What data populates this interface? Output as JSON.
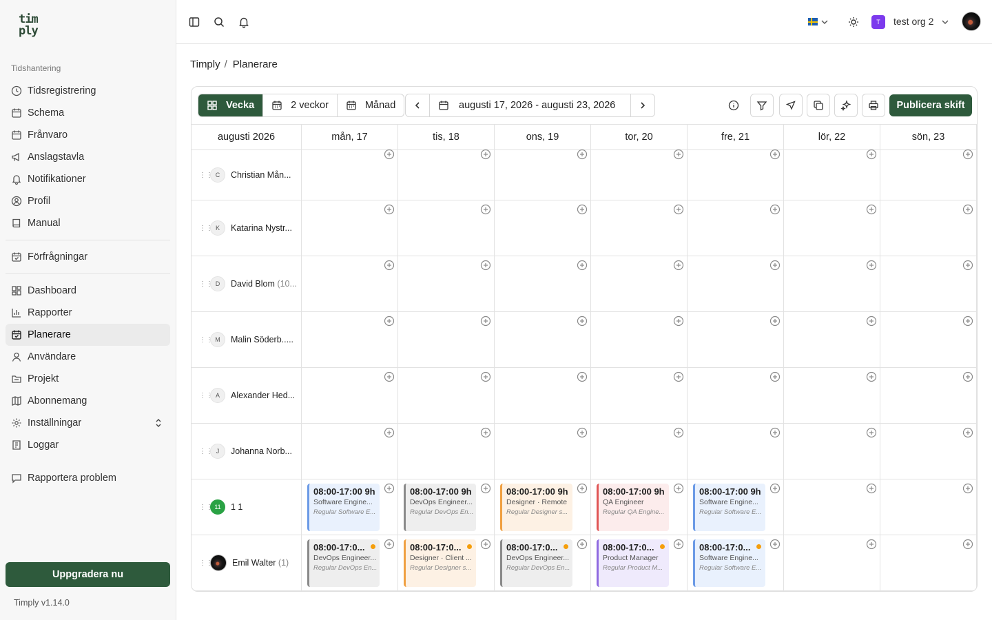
{
  "logo": {
    "line1": "tim",
    "line2": "ply"
  },
  "sidebar": {
    "section_label": "Tidshantering",
    "items": [
      {
        "label": "Tidsregistrering",
        "icon": "clock-icon"
      },
      {
        "label": "Schema",
        "icon": "calendar-icon"
      },
      {
        "label": "Frånvaro",
        "icon": "calendar-icon"
      },
      {
        "label": "Anslagstavla",
        "icon": "megaphone-icon"
      },
      {
        "label": "Notifikationer",
        "icon": "bell-icon"
      },
      {
        "label": "Profil",
        "icon": "user-circle-icon"
      },
      {
        "label": "Manual",
        "icon": "book-icon"
      },
      {
        "label": "Förfrågningar",
        "icon": "calendar-check-icon"
      },
      {
        "label": "Dashboard",
        "icon": "dashboard-icon"
      },
      {
        "label": "Rapporter",
        "icon": "bar-chart-icon"
      },
      {
        "label": "Planerare",
        "icon": "calendar-check-icon",
        "active": true
      },
      {
        "label": "Användare",
        "icon": "user-icon"
      },
      {
        "label": "Projekt",
        "icon": "folder-icon"
      },
      {
        "label": "Abonnemang",
        "icon": "map-icon"
      },
      {
        "label": "Inställningar",
        "icon": "gear-icon"
      },
      {
        "label": "Loggar",
        "icon": "log-icon"
      },
      {
        "label": "Rapportera problem",
        "icon": "message-icon"
      }
    ],
    "upgrade_label": "Uppgradera nu",
    "version": "Timply v1.14.0"
  },
  "topbar": {
    "org_badge": "T",
    "org_name": "test org 2"
  },
  "breadcrumb": [
    "Timply",
    "Planerare"
  ],
  "toolbar": {
    "views": [
      "Vecka",
      "2 veckor",
      "Månad"
    ],
    "active_view": "Vecka",
    "date_range": "augusti 17, 2026 - augusti 23, 2026",
    "publish_label": "Publicera skift"
  },
  "grid": {
    "month_label": "augusti 2026",
    "days": [
      "mån, 17",
      "tis, 18",
      "ons, 19",
      "tor, 20",
      "fre, 21",
      "lör, 22",
      "sön, 23"
    ],
    "employees": [
      {
        "initial": "C",
        "name": "Christian Mån...",
        "count": ""
      },
      {
        "initial": "K",
        "name": "Katarina Nystr...",
        "count": ""
      },
      {
        "initial": "D",
        "name": "David Blom",
        "count": "(10..."
      },
      {
        "initial": "M",
        "name": "Malin Söderb.....",
        "count": ""
      },
      {
        "initial": "A",
        "name": "Alexander Hed...",
        "count": ""
      },
      {
        "initial": "J",
        "name": "Johanna Norb...",
        "count": ""
      },
      {
        "initial": "11",
        "name": "1 1",
        "count": "",
        "avatar": "green"
      },
      {
        "initial": "",
        "name": "Emil Walter",
        "count": "(1)",
        "avatar": "photo"
      }
    ],
    "shifts_row7": [
      {
        "day": 0,
        "time": "08:00-17:00 9h",
        "role": "Software Engine...",
        "desc": "Regular Software E...",
        "color": "blue"
      },
      {
        "day": 1,
        "time": "08:00-17:00 9h",
        "role": "DevOps Engineer...",
        "desc": "Regular DevOps En...",
        "color": "gray"
      },
      {
        "day": 2,
        "time": "08:00-17:00 9h",
        "role": "Designer · Remote",
        "desc": "Regular Designer s...",
        "color": "orange"
      },
      {
        "day": 3,
        "time": "08:00-17:00 9h",
        "role": "QA Engineer",
        "desc": "Regular QA Engine...",
        "color": "red"
      },
      {
        "day": 4,
        "time": "08:00-17:00 9h",
        "role": "Software Engine...",
        "desc": "Regular Software E...",
        "color": "blue"
      }
    ],
    "shifts_row8": [
      {
        "day": 0,
        "time": "08:00-17:0...",
        "role": "DevOps Engineer...",
        "desc": "Regular DevOps En...",
        "color": "gray",
        "dot": true
      },
      {
        "day": 1,
        "time": "08:00-17:0...",
        "role": "Designer · Client ...",
        "desc": "Regular Designer s...",
        "color": "orange",
        "dot": true
      },
      {
        "day": 2,
        "time": "08:00-17:0...",
        "role": "DevOps Engineer...",
        "desc": "Regular DevOps En...",
        "color": "gray",
        "dot": true
      },
      {
        "day": 3,
        "time": "08:00-17:0...",
        "role": "Product Manager",
        "desc": "Regular Product M...",
        "color": "purple",
        "dot": true
      },
      {
        "day": 4,
        "time": "08:00-17:0...",
        "role": "Software Engine...",
        "desc": "Regular Software E...",
        "color": "blue",
        "dot": true
      }
    ]
  }
}
